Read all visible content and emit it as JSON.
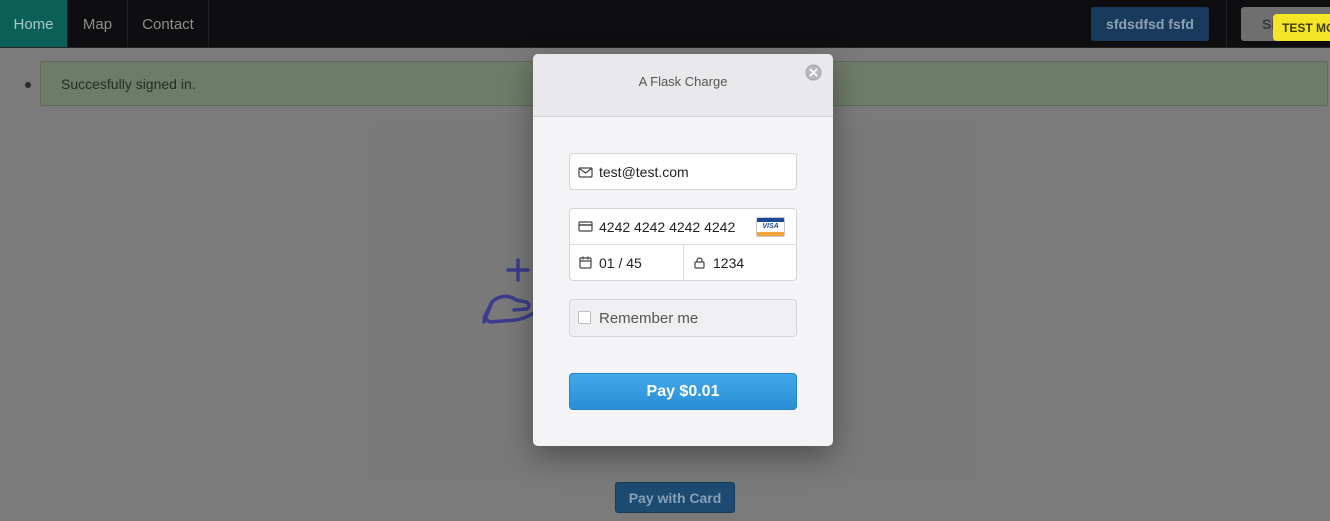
{
  "nav": {
    "items": [
      {
        "label": "Home",
        "active": true
      },
      {
        "label": "Map"
      },
      {
        "label": "Contact"
      }
    ],
    "user_button": "sfdsdfsd fsfd",
    "signout_button": "Si",
    "test_mode_badge": "TEST MO"
  },
  "flash": {
    "message": "Succesfully signed in."
  },
  "page": {
    "pay_with_card_button": "Pay with Card"
  },
  "modal": {
    "title": "A Flask Charge",
    "email": "test@test.com",
    "card_number": "4242 4242 4242 4242",
    "card_brand": "VISA",
    "expiry": "01 / 45",
    "cvc": "1234",
    "remember_label": "Remember me",
    "remember_checked": false,
    "pay_button": "Pay $0.01"
  },
  "colors": {
    "accent": "#2a8ed5",
    "home_active": "#0b5f57",
    "test_badge": "#f4e626"
  }
}
